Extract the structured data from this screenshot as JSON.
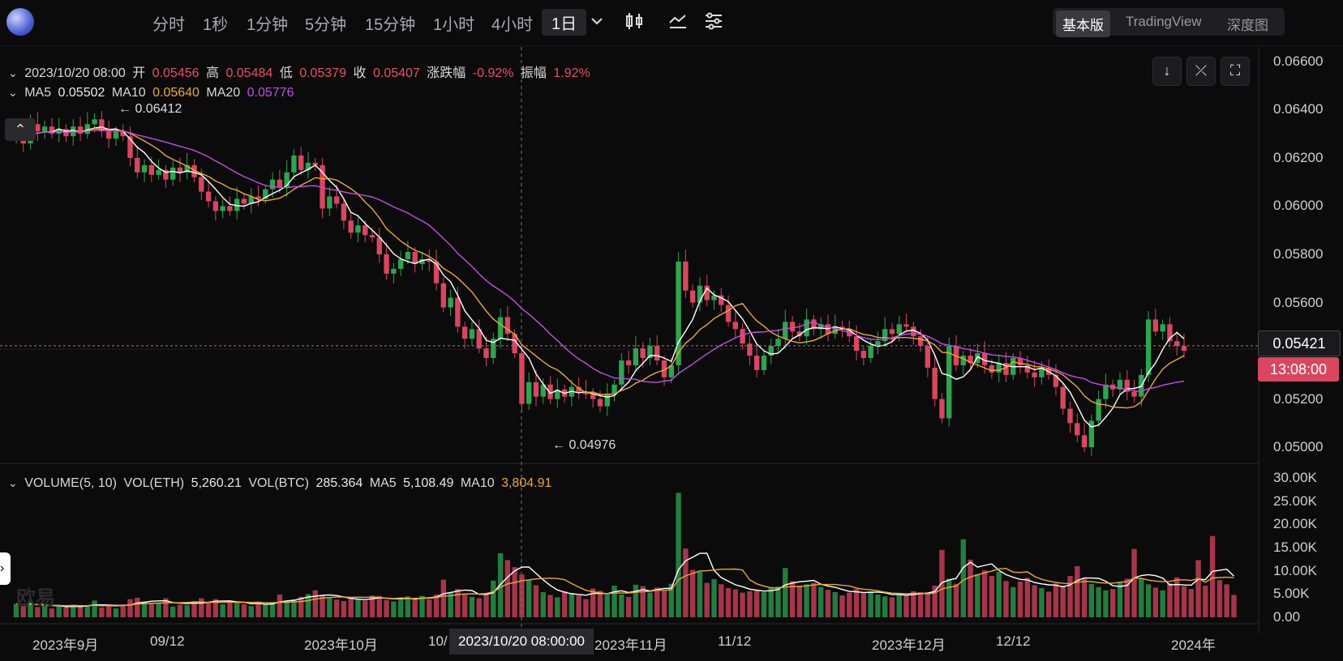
{
  "toolbar": {
    "timeframes": [
      "分时",
      "1秒",
      "1分钟",
      "5分钟",
      "15分钟",
      "1小时",
      "4小时",
      "1日"
    ],
    "active_timeframe": "1日",
    "view_modes": [
      "基本版",
      "TradingView",
      "深度图"
    ],
    "active_view": "基本版"
  },
  "ohlc": {
    "date": "2023/10/20 08:00",
    "open_label": "开",
    "open": "0.05456",
    "high_label": "高",
    "high": "0.05484",
    "low_label": "低",
    "low": "0.05379",
    "close_label": "收",
    "close": "0.05407",
    "change_label": "涨跌幅",
    "change": "-0.92%",
    "amplitude_label": "振幅",
    "amplitude": "1.92%"
  },
  "ma": {
    "ma5_label": "MA5",
    "ma5": "0.05502",
    "ma10_label": "MA10",
    "ma10": "0.05640",
    "ma20_label": "MA20",
    "ma20": "0.05776"
  },
  "volume": {
    "title": "VOLUME(5, 10)",
    "vol_eth_label": "VOL(ETH)",
    "vol_eth": "5,260.21",
    "vol_btc_label": "VOL(BTC)",
    "vol_btc": "285.364",
    "ma5_label": "MA5",
    "ma5": "5,108.49",
    "ma10_label": "MA10",
    "ma10": "3,804.91"
  },
  "markers": {
    "high": "← 0.06412",
    "low": "← 0.04976"
  },
  "price_tags": {
    "current_price": "0.05421",
    "countdown": "13:08:00"
  },
  "cursor_date": "2023/10/20 08:00:00",
  "watermark": "欧易",
  "colors": {
    "up": "#2ea44f",
    "down": "#d9465f",
    "ma5": "#ffffff",
    "ma10": "#e9a73b",
    "ma20": "#c44de0"
  },
  "chart_data": [
    {
      "type": "candlestick",
      "title": "",
      "x_tick_labels": [
        "2023年9月",
        "09/12",
        "2023年10月",
        "10/",
        "2023年11月",
        "11/12",
        "2023年12月",
        "12/12",
        "2024年"
      ],
      "y_tick_labels": [
        "0.06600",
        "0.06400",
        "0.06200",
        "0.06000",
        "0.05800",
        "0.05600",
        "0.05400",
        "0.05200",
        "0.05000"
      ],
      "ylim": [
        0.0494,
        0.0666
      ],
      "close": [
        0.063,
        0.0626,
        0.0634,
        0.0631,
        0.0633,
        0.063,
        0.0632,
        0.0629,
        0.0633,
        0.063,
        0.0634,
        0.0636,
        0.0631,
        0.0628,
        0.0631,
        0.0629,
        0.062,
        0.0614,
        0.0617,
        0.0613,
        0.0615,
        0.0611,
        0.0616,
        0.0614,
        0.0617,
        0.0612,
        0.0606,
        0.0602,
        0.0598,
        0.06,
        0.0598,
        0.0603,
        0.0601,
        0.0604,
        0.0603,
        0.0607,
        0.0611,
        0.0608,
        0.0614,
        0.0621,
        0.0615,
        0.0618,
        0.0617,
        0.0599,
        0.0604,
        0.0601,
        0.0594,
        0.0589,
        0.0592,
        0.0588,
        0.0587,
        0.058,
        0.0572,
        0.0574,
        0.0578,
        0.0581,
        0.0576,
        0.0578,
        0.0577,
        0.0568,
        0.0558,
        0.0562,
        0.055,
        0.0545,
        0.0549,
        0.0541,
        0.0537,
        0.0545,
        0.0554,
        0.0547,
        0.0539,
        0.0518,
        0.0527,
        0.0521,
        0.0526,
        0.052,
        0.0524,
        0.0521,
        0.0525,
        0.0523,
        0.0522,
        0.052,
        0.0517,
        0.0522,
        0.0526,
        0.0536,
        0.0534,
        0.0541,
        0.0537,
        0.0542,
        0.0536,
        0.0529,
        0.0534,
        0.0577,
        0.0565,
        0.056,
        0.0567,
        0.0561,
        0.0563,
        0.0559,
        0.0552,
        0.0549,
        0.0543,
        0.0538,
        0.0532,
        0.0538,
        0.0542,
        0.0545,
        0.0552,
        0.0548,
        0.0546,
        0.0553,
        0.0549,
        0.0551,
        0.0547,
        0.055,
        0.0549,
        0.0546,
        0.054,
        0.0537,
        0.0542,
        0.0544,
        0.0549,
        0.0547,
        0.0551,
        0.055,
        0.0546,
        0.0542,
        0.0533,
        0.052,
        0.0512,
        0.0542,
        0.0534,
        0.0538,
        0.0535,
        0.0539,
        0.0534,
        0.0531,
        0.0535,
        0.053,
        0.0537,
        0.0534,
        0.0531,
        0.0529,
        0.0533,
        0.053,
        0.0525,
        0.0516,
        0.051,
        0.0505,
        0.05,
        0.0511,
        0.052,
        0.0526,
        0.0524,
        0.0528,
        0.0523,
        0.0521,
        0.053,
        0.0553,
        0.0548,
        0.0551,
        0.0544,
        0.0542,
        0.054
      ]
    },
    {
      "type": "bar",
      "title": "",
      "y_tick_labels": [
        "30.00K",
        "25.00K",
        "20.00K",
        "15.00K",
        "10.00K",
        "5.00K",
        "0.00"
      ],
      "ylim": [
        0,
        30000
      ],
      "values": [
        2900,
        2400,
        3400,
        2200,
        2600,
        1900,
        2500,
        2100,
        2700,
        2300,
        2600,
        3600,
        2100,
        2600,
        1900,
        2700,
        3900,
        4200,
        3400,
        3100,
        3000,
        4100,
        2300,
        2700,
        2600,
        3500,
        4100,
        3200,
        3900,
        2800,
        3600,
        3000,
        2800,
        2400,
        3100,
        2700,
        3300,
        4900,
        3600,
        3800,
        4400,
        5000,
        5800,
        4700,
        4100,
        3800,
        3500,
        4200,
        3900,
        3600,
        4700,
        4600,
        3700,
        3400,
        4200,
        4500,
        3900,
        4600,
        3800,
        4900,
        8100,
        5300,
        6100,
        4900,
        4400,
        4100,
        5100,
        7900,
        13800,
        12300,
        10800,
        9200,
        8000,
        6900,
        5400,
        4800,
        4300,
        5600,
        5200,
        4700,
        3900,
        6200,
        5700,
        4900,
        6800,
        4900,
        4400,
        7000,
        6700,
        5300,
        6400,
        5600,
        7200,
        26800,
        14800,
        10200,
        9800,
        7400,
        8200,
        7100,
        6300,
        6000,
        5300,
        5600,
        5900,
        5400,
        6400,
        6600,
        10600,
        7800,
        6800,
        7100,
        7400,
        6500,
        5900,
        5400,
        4700,
        5300,
        6100,
        5200,
        5600,
        4900,
        4500,
        4300,
        5200,
        4900,
        5600,
        5400,
        5000,
        6800,
        14500,
        8300,
        7200,
        16800,
        12400,
        9300,
        10100,
        8900,
        9800,
        7800,
        6500,
        7700,
        8500,
        6900,
        6300,
        5500,
        7300,
        6800,
        8900,
        11000,
        8300,
        7200,
        6500,
        5800,
        6100,
        7600,
        8300,
        14700,
        8200,
        7100,
        6400,
        5800,
        7300,
        8600,
        6700,
        6100,
        12300,
        6800,
        17500,
        8000,
        7100,
        4800
      ]
    }
  ]
}
